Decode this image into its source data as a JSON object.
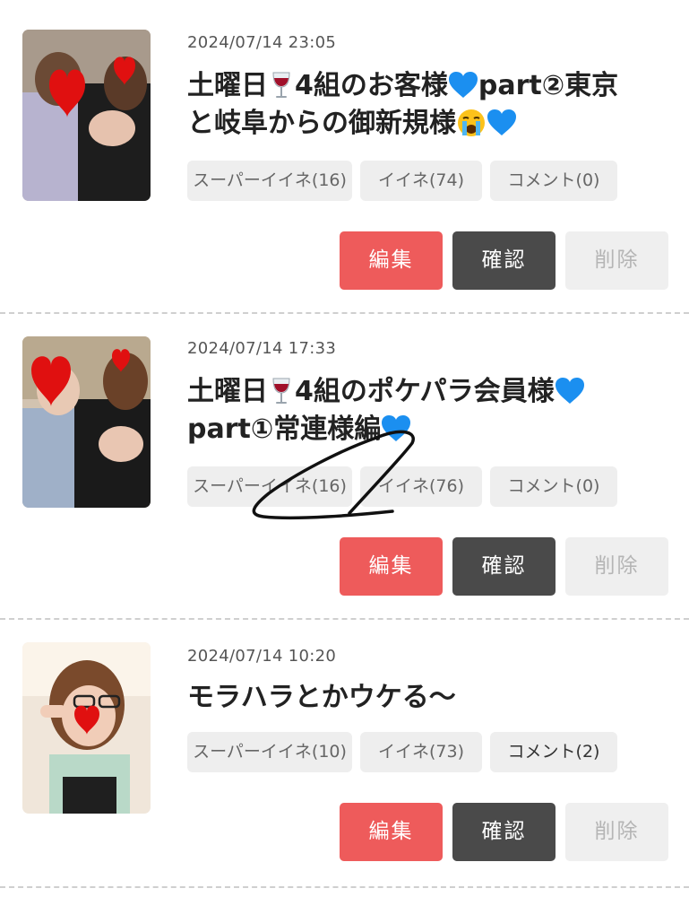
{
  "posts": [
    {
      "date": "2024/07/14 23:05",
      "title_parts": [
        "土曜日",
        "4組のお客様",
        "part②東京",
        "と岐阜からの御新規様"
      ],
      "tags": {
        "super_like": "スーパーイイネ(16)",
        "like": "イイネ(74)",
        "comment": "コメント(0)"
      },
      "actions": {
        "edit": "編集",
        "check": "確認",
        "delete": "削除"
      }
    },
    {
      "date": "2024/07/14 17:33",
      "title_parts": [
        "土曜日",
        "4組のポケパラ会員様",
        "part①常連様編"
      ],
      "tags": {
        "super_like": "スーパーイイネ(16)",
        "like": "イイネ(76)",
        "comment": "コメント(0)"
      },
      "actions": {
        "edit": "編集",
        "check": "確認",
        "delete": "削除"
      }
    },
    {
      "date": "2024/07/14 10:20",
      "title_parts": [
        "モラハラとかウケる〜"
      ],
      "tags": {
        "super_like": "スーパーイイネ(10)",
        "like": "イイネ(73)",
        "comment": "コメント(2)"
      },
      "actions": {
        "edit": "編集",
        "check": "確認",
        "delete": "削除"
      }
    }
  ],
  "icons": {
    "wine": "wine-glass-icon",
    "heart": "blue-heart-icon",
    "cry": "crying-face-icon"
  },
  "colors": {
    "edit": "#ee5b5b",
    "check": "#4a4a4a",
    "delete_bg": "#efefef",
    "tag_bg": "#eeeeee",
    "divider": "#cfcfcf"
  }
}
